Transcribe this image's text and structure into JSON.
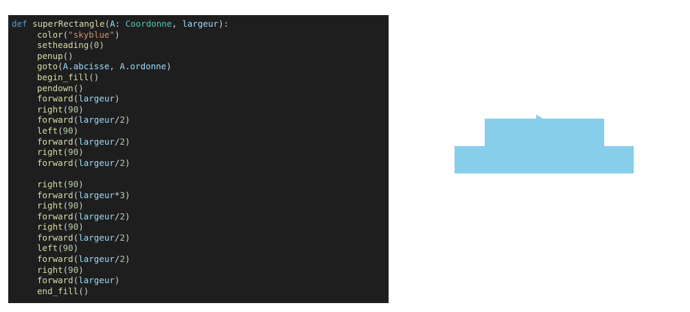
{
  "editor": {
    "lines": [
      "def superRectangle(A: Coordonne, largeur):",
      "color(\"skyblue\")",
      "setheading(0)",
      "penup()",
      "goto(A.abcisse, A.ordonne)",
      "begin_fill()",
      "pendown()",
      "forward(largeur)",
      "right(90)",
      "forward(largeur/2)",
      "left(90)",
      "forward(largeur/2)",
      "right(90)",
      "forward(largeur/2)",
      "",
      "right(90)",
      "forward(largeur*3)",
      "right(90)",
      "forward(largeur/2)",
      "right(90)",
      "forward(largeur/2)",
      "left(90)",
      "forward(largeur/2)",
      "right(90)",
      "forward(largeur)",
      "end_fill()"
    ],
    "status_icon": "document-icon"
  },
  "canvas": {
    "fill_color": "#87ceeb",
    "shape_color_name": "skyblue"
  },
  "colors": {
    "editor_bg": "#1e1e1e",
    "keyword": "#569cd6",
    "function": "#dcdcaa",
    "parameter": "#9cdcfe",
    "type": "#4ec9b0",
    "string": "#ce9178",
    "number": "#b5cea8"
  }
}
